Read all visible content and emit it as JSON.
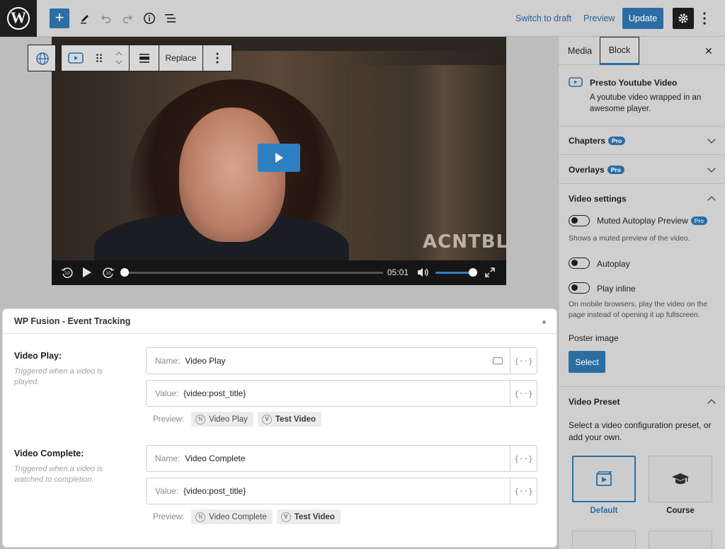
{
  "topbar": {
    "logo": "W",
    "switch_to_draft": "Switch to draft",
    "preview": "Preview",
    "update": "Update",
    "icons": [
      "add-block-icon",
      "pencil-icon",
      "undo-icon",
      "redo-icon",
      "info-icon",
      "list-view-icon",
      "gear-icon",
      "kebab-icon"
    ]
  },
  "block_toolbar": {
    "replace": "Replace"
  },
  "video": {
    "watermark": "ACNTBL",
    "time": "05:01",
    "progress": 0.0,
    "volume": 1.0
  },
  "fusion": {
    "title": "WP Fusion - Event Tracking",
    "events": [
      {
        "label": "Video Play:",
        "desc": "Triggered when a video is played.",
        "name_label": "Name:",
        "name_value": "Video Play",
        "value_label": "Value:",
        "value_value": "{video:post_title}",
        "preview_label": "Preview:",
        "chip1_badge": "N",
        "chip1": "Video Play",
        "chip2_badge": "V",
        "chip2": "Test Video"
      },
      {
        "label": "Video Complete:",
        "desc": "Triggered when a video is watched to completion.",
        "name_label": "Name:",
        "name_value": "Video Complete",
        "value_label": "Value:",
        "value_value": "{video:post_title}",
        "preview_label": "Preview:",
        "chip1_badge": "N",
        "chip1": "Video Complete",
        "chip2_badge": "V",
        "chip2": "Test Video"
      }
    ],
    "merge_icon": "{··}"
  },
  "sidebar": {
    "tabs": [
      "Media",
      "Block"
    ],
    "close": "✕",
    "block_name": "Presto Youtube Video",
    "block_desc": "A youtube video wrapped in an awesome player.",
    "chapters": "Chapters",
    "overlays": "Overlays",
    "pro": "Pro",
    "video_settings": "Video settings",
    "muted_autoplay": "Muted Autoplay Preview",
    "muted_help": "Shows a muted preview of the video.",
    "autoplay": "Autoplay",
    "play_inline": "Play inline",
    "inline_help": "On mobile browsers, play the video on the page instead of opening it up fullscreen.",
    "poster_image": "Poster image",
    "select": "Select",
    "video_preset": "Video Preset",
    "preset_help": "Select a video configuration preset, or add your own.",
    "presets": [
      "Default",
      "Course"
    ]
  },
  "colors": {
    "accent": "#2d6da3",
    "play_button": "#2f7fc3"
  }
}
